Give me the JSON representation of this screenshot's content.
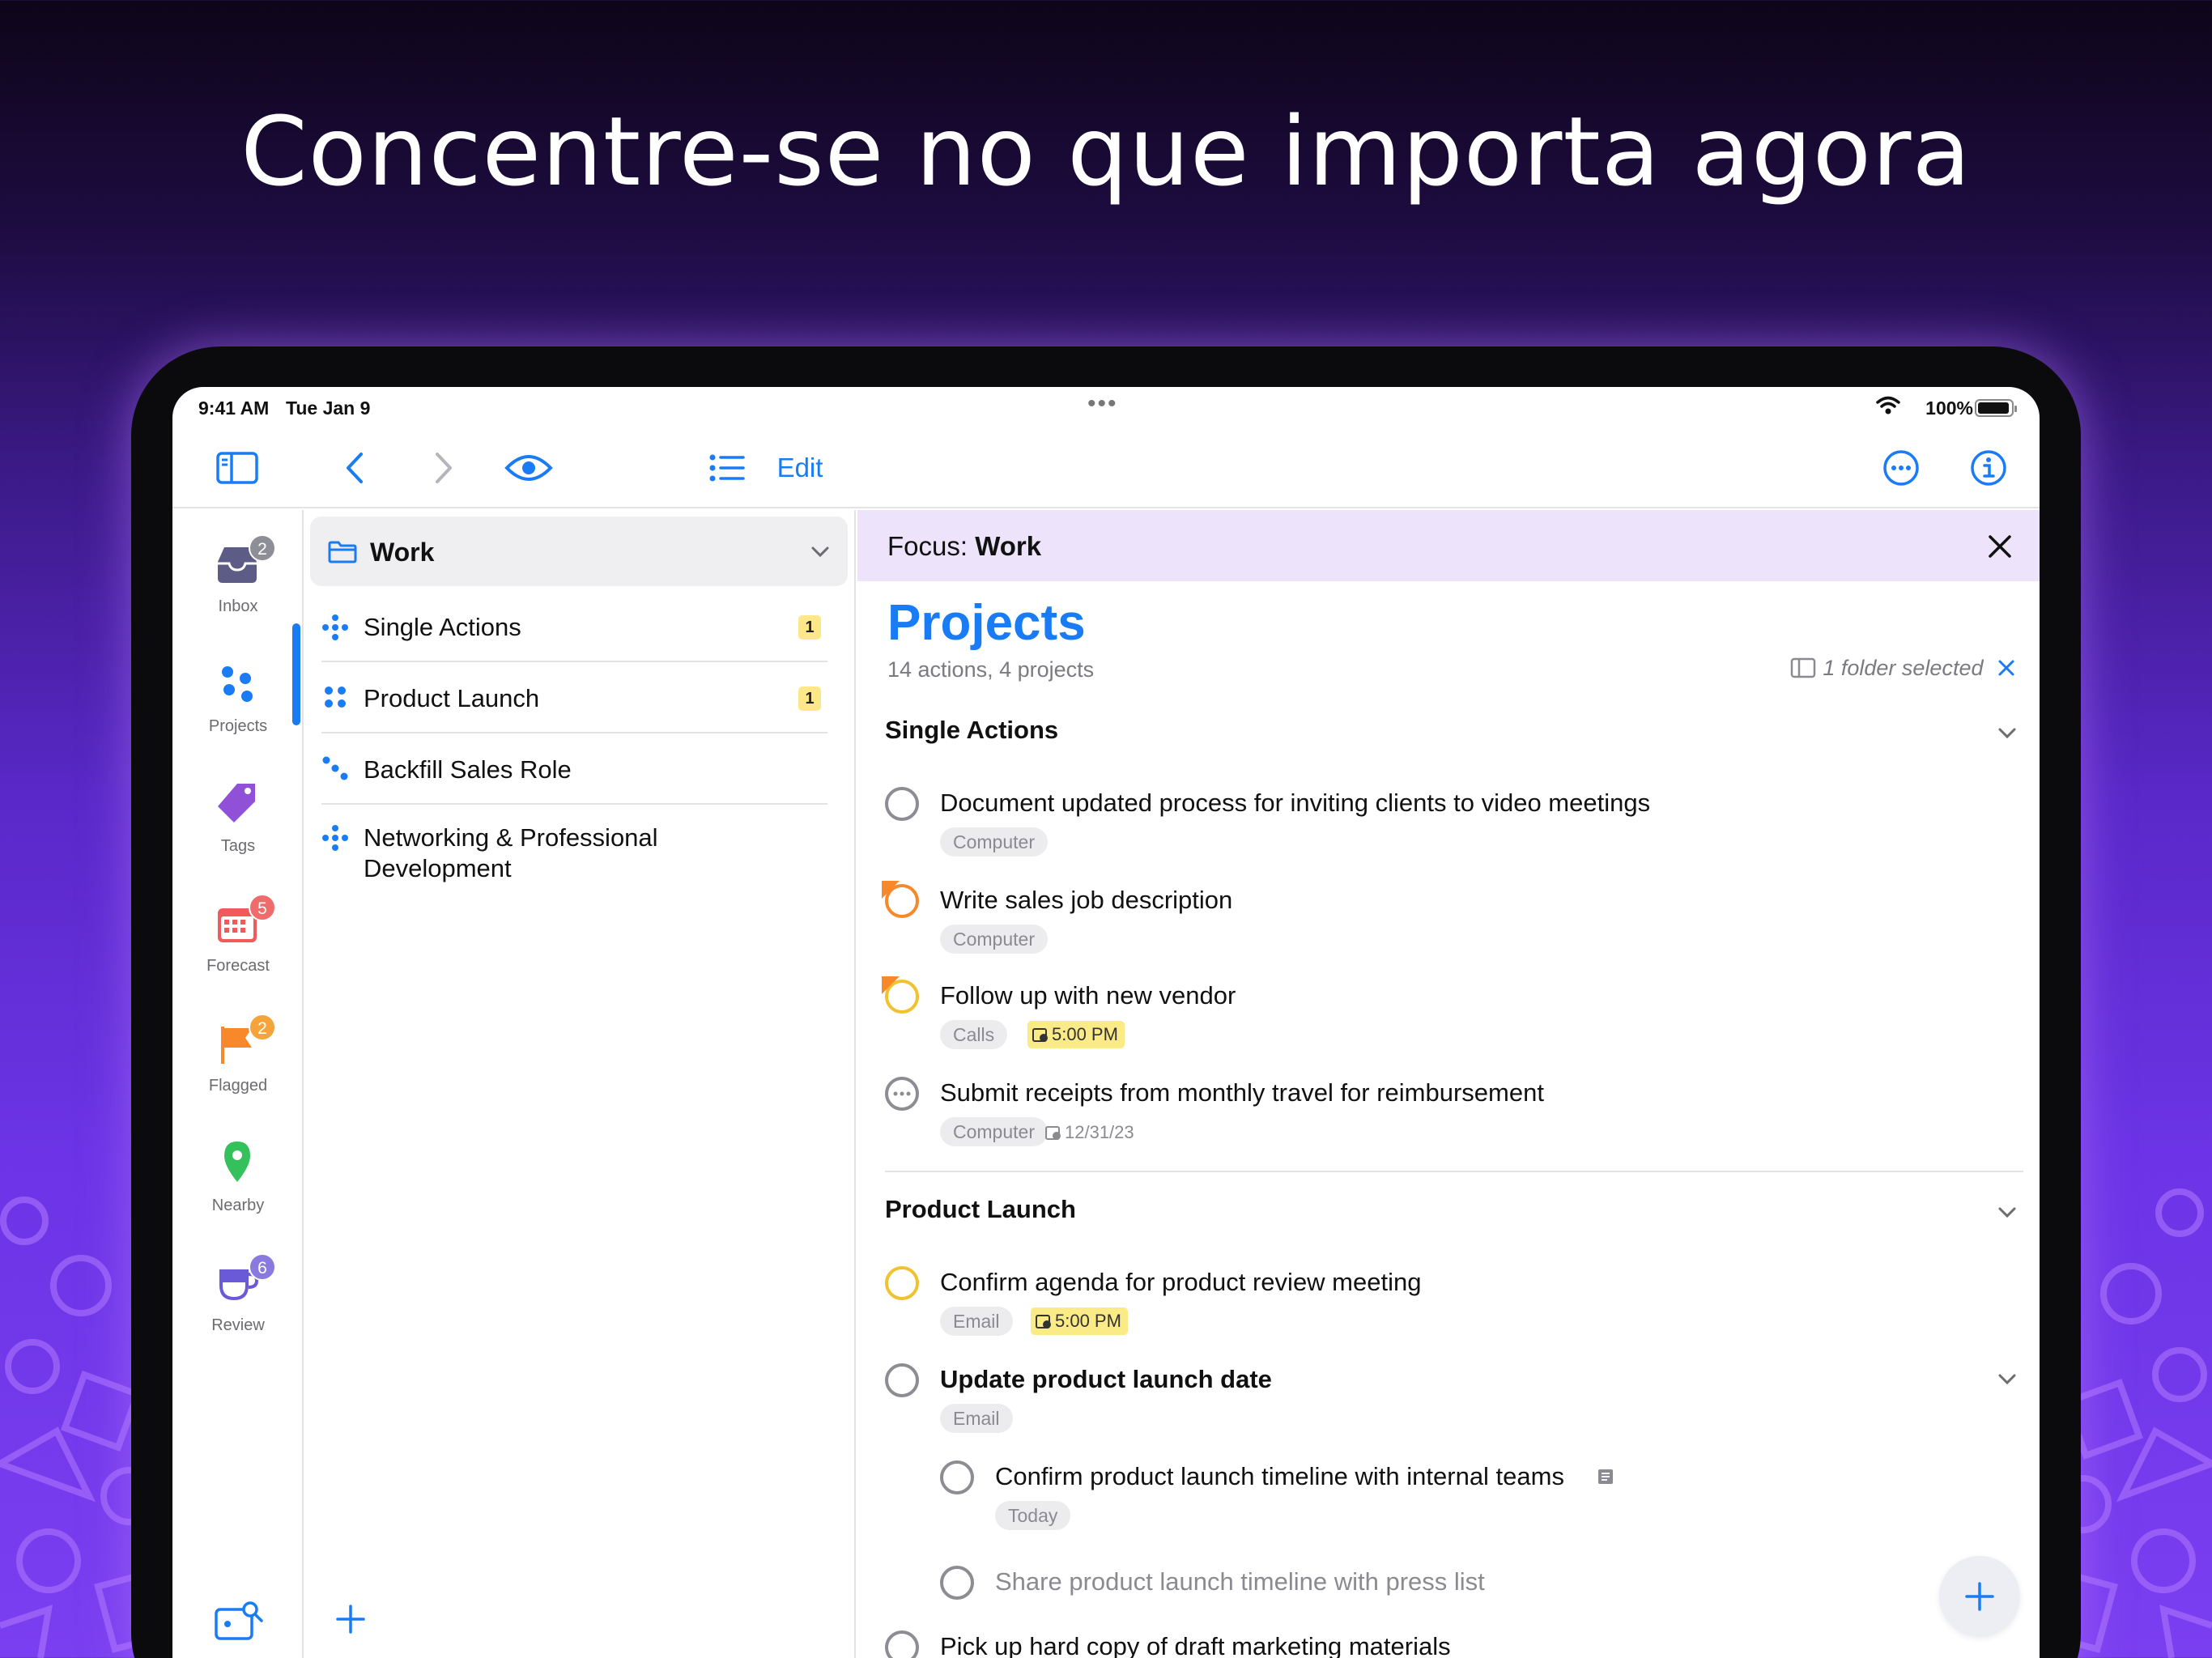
{
  "headline": "Concentre-se no que importa agora",
  "status_bar": {
    "time": "9:41 AM",
    "date": "Tue Jan 9",
    "battery": "100%"
  },
  "toolbar": {
    "edit_label": "Edit"
  },
  "sidebar": {
    "items": [
      {
        "label": "Inbox",
        "badge": "2",
        "icon": "inbox-icon"
      },
      {
        "label": "Projects",
        "badge": "",
        "icon": "projects-icon"
      },
      {
        "label": "Tags",
        "badge": "",
        "icon": "tag-icon"
      },
      {
        "label": "Forecast",
        "badge": "5",
        "icon": "calendar-icon"
      },
      {
        "label": "Flagged",
        "badge": "2",
        "icon": "flag-icon"
      },
      {
        "label": "Nearby",
        "badge": "",
        "icon": "location-pin-icon"
      },
      {
        "label": "Review",
        "badge": "6",
        "icon": "review-cup-icon"
      }
    ]
  },
  "project_list": {
    "folder": "Work",
    "projects": [
      {
        "name": "Single Actions",
        "badge": "1"
      },
      {
        "name": "Product Launch",
        "badge": "1"
      },
      {
        "name": "Backfill Sales Role",
        "badge": ""
      },
      {
        "name_line1": "Networking & Professional",
        "name_line2": "Development",
        "badge": ""
      }
    ]
  },
  "main": {
    "focus_label": "Focus:",
    "focus_value": "Work",
    "title": "Projects",
    "subtitle": "14 actions, 4 projects",
    "selection": "1 folder selected",
    "sections": [
      {
        "name": "Single Actions",
        "tasks": [
          {
            "title": "Document updated process for inviting clients to video meetings",
            "tag": "Computer"
          },
          {
            "title": "Write sales job description",
            "tag": "Computer"
          },
          {
            "title": "Follow up with new vendor",
            "tag": "Calls",
            "due": "5:00 PM"
          },
          {
            "title": "Submit receipts from monthly travel for reimbursement",
            "tag": "Computer",
            "date": "12/31/23"
          }
        ]
      },
      {
        "name": "Product Launch",
        "tasks": [
          {
            "title": "Confirm agenda for product review meeting",
            "tag": "Email",
            "due": "5:00 PM"
          },
          {
            "title": "Update product launch date",
            "tag": "Email"
          },
          {
            "title": "Confirm product launch timeline with internal teams",
            "tag": "Today"
          },
          {
            "title": "Share product launch timeline with press list"
          },
          {
            "title": "Pick up hard copy of draft marketing materials"
          }
        ]
      }
    ]
  },
  "colors": {
    "accent": "#1a7cf5",
    "focus_bar": "#ede3fb",
    "due_highlight": "#fbeb86",
    "flag_orange": "#f7892a",
    "badge_gray": "#8e8e96",
    "badge_red": "#f06b6b",
    "badge_orange": "#f5a33b",
    "badge_purple": "#8a7ae0"
  }
}
